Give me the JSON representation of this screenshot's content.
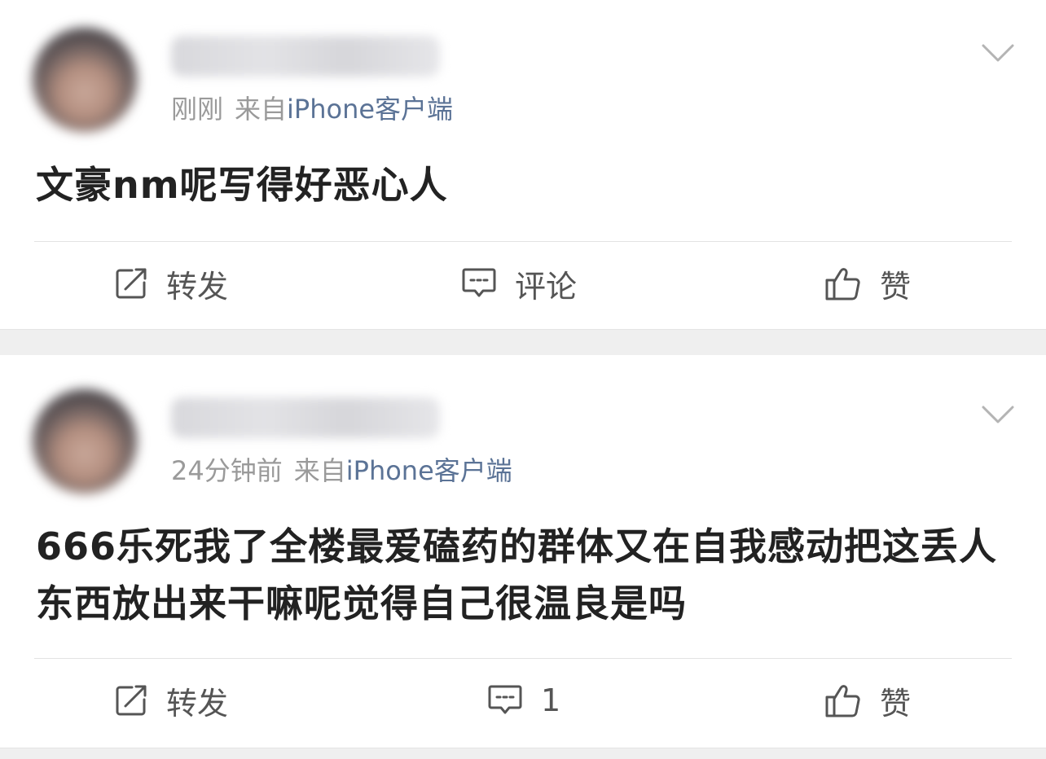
{
  "posts": [
    {
      "time": "刚刚",
      "from": "来自",
      "source": "iPhone客户端",
      "content": "文豪nm呢写得好恶心人",
      "actions": {
        "repost": "转发",
        "comment": "评论",
        "like": "赞"
      }
    },
    {
      "time": "24分钟前",
      "from": "来自",
      "source": "iPhone客户端",
      "content": "666乐死我了全楼最爱磕药的群体又在自我感动把这丢人东西放出来干嘛呢觉得自己很温良是吗",
      "actions": {
        "repost": "转发",
        "comment": "1",
        "like": "赞"
      }
    }
  ],
  "colors": {
    "text": "#222222",
    "meta": "#9a9a9a",
    "source_link": "#5b7396",
    "action": "#555555",
    "separator": "#efefef"
  },
  "icons": [
    "avatar",
    "chevron-down-icon",
    "repost-icon",
    "comment-icon",
    "like-icon"
  ]
}
